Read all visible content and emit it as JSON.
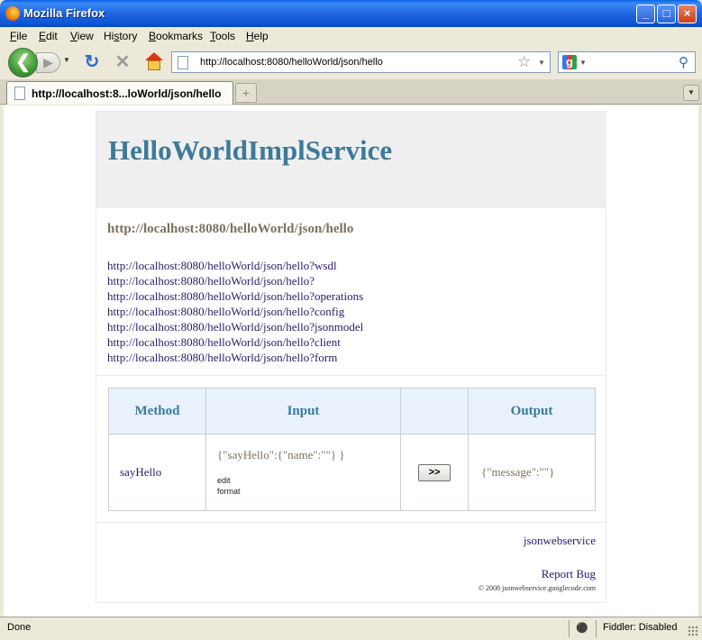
{
  "window": {
    "title": "Mozilla Firefox",
    "minimize_glyph": "_",
    "maximize_glyph": "□",
    "close_glyph": "×"
  },
  "menu": [
    {
      "key": "F",
      "rest": "ile"
    },
    {
      "key": "E",
      "rest": "dit"
    },
    {
      "key": "V",
      "rest": "iew"
    },
    {
      "key": "",
      "pre": "Hi",
      "key2": "s",
      "rest": "tory"
    },
    {
      "key": "B",
      "rest": "ookmarks"
    },
    {
      "key": "T",
      "rest": "ools"
    },
    {
      "key": "H",
      "rest": "elp"
    }
  ],
  "nav": {
    "url": "http://localhost:8080/helloWorld/json/hello",
    "search_value": "",
    "icons": [
      "back-icon",
      "forward-icon",
      "reload-icon",
      "stop-icon",
      "home-icon",
      "bookmark-star-icon",
      "google-icon",
      "magnifier-icon"
    ]
  },
  "tabs": [
    {
      "label": "http://localhost:8...loWorld/json/hello"
    }
  ],
  "page": {
    "title": "HelloWorldImplService",
    "endpoint": "http://localhost:8080/helloWorld/json/hello",
    "links": [
      "http://localhost:8080/helloWorld/json/hello?wsdl",
      "http://localhost:8080/helloWorld/json/hello?",
      "http://localhost:8080/helloWorld/json/hello?operations",
      "http://localhost:8080/helloWorld/json/hello?config",
      "http://localhost:8080/helloWorld/json/hello?jsonmodel",
      "http://localhost:8080/helloWorld/json/hello?client",
      "http://localhost:8080/helloWorld/json/hello?form"
    ],
    "table": {
      "headers": [
        "Method",
        "Input",
        "",
        "Output"
      ],
      "rows": [
        {
          "method": "sayHello",
          "input": "{\"sayHello\":{\"name\":\"\"} }",
          "edit_label": "edit",
          "format_label": "format",
          "button_label": ">>",
          "output": "{\"message\":\"\"}"
        }
      ]
    },
    "footer": {
      "link": "jsonwebservice",
      "report_bug": "Report Bug",
      "copyright": "© 2008 jsonwebservice.googlecode.com"
    }
  },
  "status": {
    "text": "Done",
    "fiddler": "Fiddler: Disabled"
  },
  "colors": {
    "title_blue": "#3c7a98",
    "link_purple": "#2a1a6a",
    "table_header_bg": "#e8f1fc",
    "header_bg": "#efefef"
  }
}
